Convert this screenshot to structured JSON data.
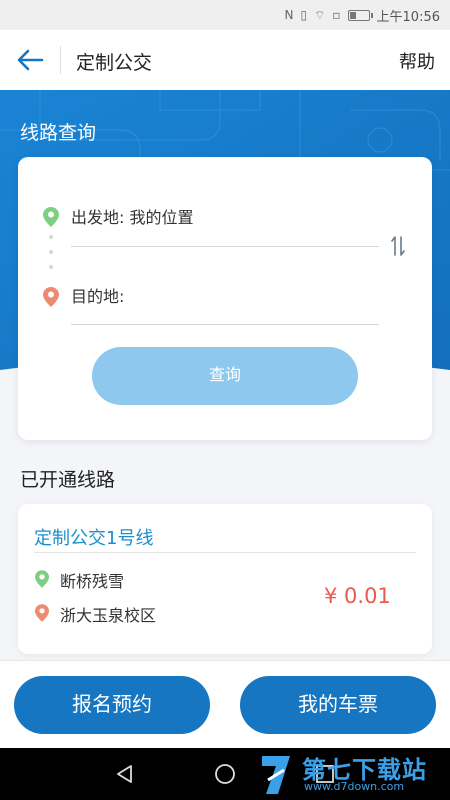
{
  "status_bar": {
    "icons": [
      "nfc-icon",
      "vibrate-icon",
      "wifi-icon",
      "sim-icon",
      "battery-icon"
    ],
    "time": "上午10:56"
  },
  "header": {
    "title": "定制公交",
    "help_label": "帮助"
  },
  "query": {
    "section_title": "线路查询",
    "from_label": "出发地: 我的位置",
    "to_label": "目的地:",
    "query_button": "查询"
  },
  "routes": {
    "section_title": "已开通线路",
    "items": [
      {
        "name": "定制公交1号线",
        "stops": [
          "断桥残雪",
          "浙大玉泉校区"
        ],
        "price": "¥ 0.01"
      }
    ]
  },
  "actions": {
    "signup_label": "报名预约",
    "tickets_label": "我的车票"
  },
  "watermark": {
    "text": "第七下载站",
    "url": "www.d7down.com"
  },
  "colors": {
    "primary_blue": "#1676c1",
    "banner_blue": "#1a7fcf",
    "query_button": "#8fc8ee",
    "route_name": "#1b8fcc",
    "price_red": "#e85a4f",
    "pin_green": "#7fcf83",
    "pin_red": "#ef8a72"
  }
}
